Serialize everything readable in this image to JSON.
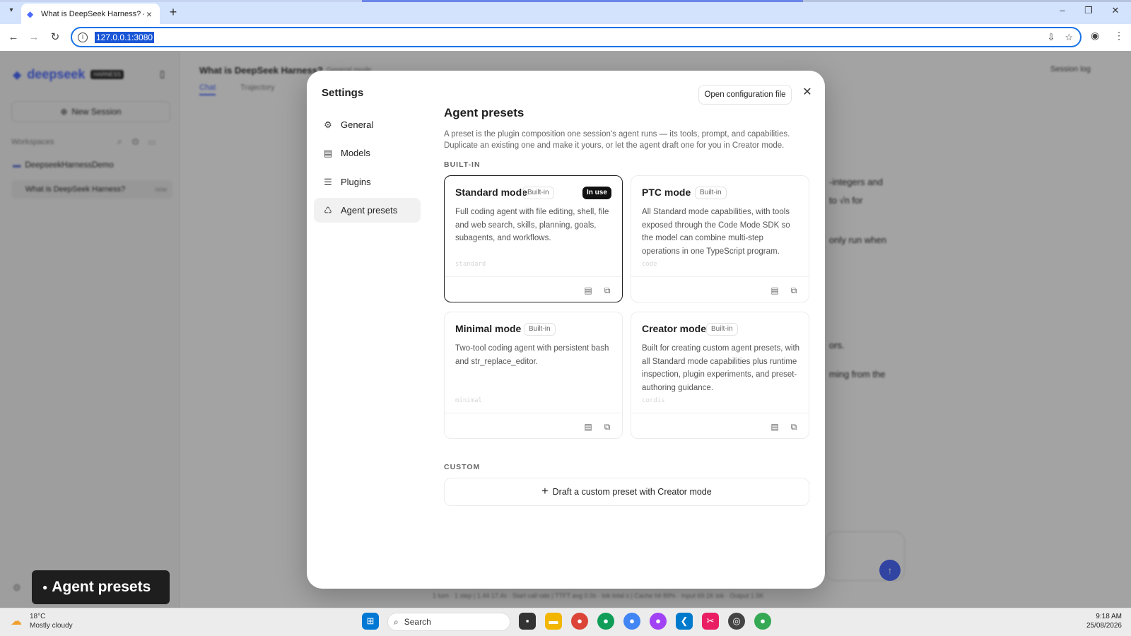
{
  "browser": {
    "tab_title": "What is DeepSeek Harness? —",
    "url": "127.0.0.1:3080"
  },
  "background": {
    "brand": "deepseek",
    "brand_badge": "HARNESS",
    "new_session": "New Session",
    "workspaces_label": "Workspaces",
    "workspace": "DeepseekHarnessDemo",
    "session_item": "What is DeepSeek Harness?",
    "session_age": "now",
    "chat_title": "What is DeepSeek Harness?",
    "chat_subtitle": "General mode",
    "tab_chat": "Chat",
    "tab_trajectory": "Trajectory",
    "session_log": "Session log",
    "fragments": [
      "-integers and",
      "to √n for",
      "only run when",
      "ors.",
      "ming from the"
    ],
    "status_bar": "1 turn · 1 step | 1.44 17.4s · Start call rate | TTFT avg 0.0s · tok total s | Cache hit 89% · Input 69.1K tok · Output 1.5K"
  },
  "settings": {
    "title": "Settings",
    "nav": [
      {
        "label": "General",
        "icon": "gear-icon"
      },
      {
        "label": "Models",
        "icon": "database-icon"
      },
      {
        "label": "Plugins",
        "icon": "sliders-icon"
      },
      {
        "label": "Agent presets",
        "icon": "robot-icon",
        "active": true
      }
    ],
    "open_config": "Open configuration file",
    "heading": "Agent presets",
    "description": "A preset is the plugin composition one session's agent runs — its tools, prompt, and capabilities. Duplicate an existing one and make it yours, or let the agent draft one for you in Creator mode.",
    "builtin_label": "BUILT-IN",
    "custom_label": "CUSTOM",
    "presets": [
      {
        "title": "Standard mode",
        "badge": "Built-in",
        "in_use": "In use",
        "description": "Full coding agent with file editing, shell, file and web search, skills, planning, goals, subagents, and workflows.",
        "slug": "standard"
      },
      {
        "title": "PTC mode",
        "badge": "Built-in",
        "description": "All Standard mode capabilities, with tools exposed through the Code Mode SDK so the model can combine multi-step operations in one TypeScript program.",
        "slug": "code"
      },
      {
        "title": "Minimal mode",
        "badge": "Built-in",
        "description": "Two-tool coding agent with persistent bash and str_replace_editor.",
        "slug": "minimal"
      },
      {
        "title": "Creator mode",
        "badge": "Built-in",
        "description": "Built for creating custom agent presets, with all Standard mode capabilities plus runtime inspection, plugin experiments, and preset-authoring guidance.",
        "slug": "cordis"
      }
    ],
    "draft_button": "Draft a custom preset with Creator mode"
  },
  "toast": "Agent presets",
  "taskbar": {
    "temperature": "18°C",
    "weather": "Mostly cloudy",
    "search_placeholder": "Search",
    "time": "9:18 AM",
    "date": "25/08/2026"
  }
}
